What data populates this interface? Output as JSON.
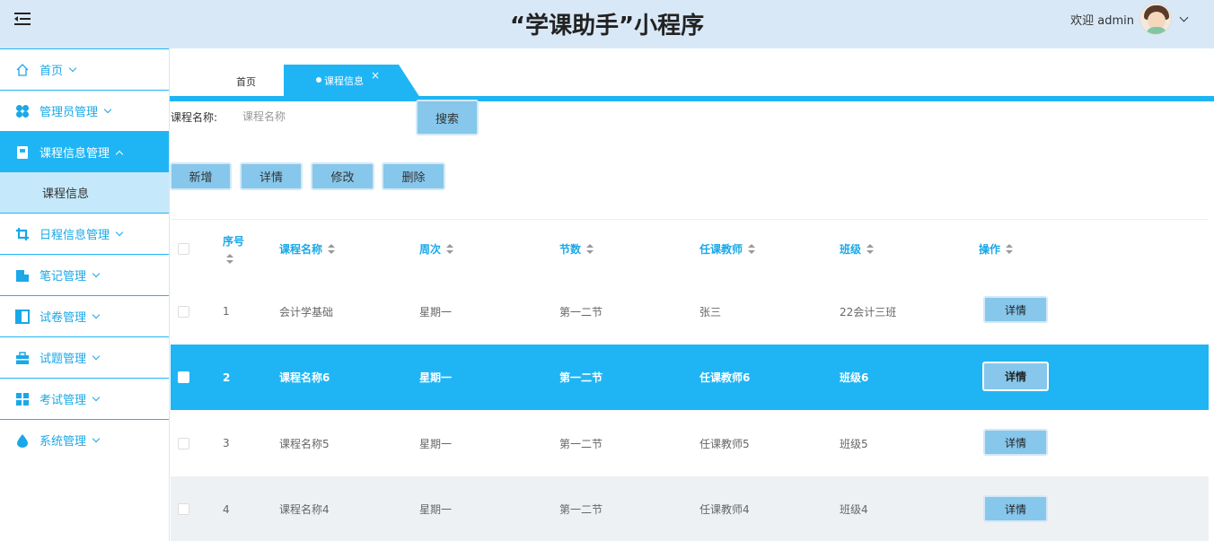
{
  "header": {
    "title": "“学课助手”小程序",
    "welcome": "欢迎 admin"
  },
  "sidebar": {
    "items": [
      {
        "label": "首页",
        "icon": "home-icon"
      },
      {
        "label": "管理员管理",
        "icon": "clover-icon"
      },
      {
        "label": "课程信息管理",
        "icon": "book-icon",
        "active": true
      },
      {
        "label": "日程信息管理",
        "icon": "crop-icon"
      },
      {
        "label": "笔记管理",
        "icon": "note-icon"
      },
      {
        "label": "试卷管理",
        "icon": "panel-icon"
      },
      {
        "label": "试题管理",
        "icon": "toolbox-icon"
      },
      {
        "label": "考试管理",
        "icon": "grid-icon"
      },
      {
        "label": "系统管理",
        "icon": "drop-icon"
      }
    ],
    "sub_item": "课程信息"
  },
  "tabs": {
    "home": "首页",
    "active": "课程信息",
    "close": "×"
  },
  "search": {
    "label": "课程名称:",
    "placeholder": "课程名称",
    "button": "搜索"
  },
  "actions": {
    "add": "新增",
    "detail": "详情",
    "edit": "修改",
    "delete": "删除"
  },
  "table": {
    "headers": [
      "序号",
      "课程名称",
      "周次",
      "节数",
      "任课教师",
      "班级",
      "操作"
    ],
    "rows": [
      {
        "no": "1",
        "name": "会计学基础",
        "week": "星期一",
        "period": "第一二节",
        "teacher": "张三",
        "class": "22会计三班",
        "op": "详情"
      },
      {
        "no": "2",
        "name": "课程名称6",
        "week": "星期一",
        "period": "第一二节",
        "teacher": "任课教师6",
        "class": "班级6",
        "op": "详情"
      },
      {
        "no": "3",
        "name": "课程名称5",
        "week": "星期一",
        "period": "第一二节",
        "teacher": "任课教师5",
        "class": "班级5",
        "op": "详情"
      },
      {
        "no": "4",
        "name": "课程名称4",
        "week": "星期一",
        "period": "第一二节",
        "teacher": "任课教师4",
        "class": "班级4",
        "op": "详情"
      }
    ]
  },
  "colors": {
    "accent": "#1fb5f5",
    "header_bg": "#d9e8f7",
    "button": "#86c7eb"
  }
}
